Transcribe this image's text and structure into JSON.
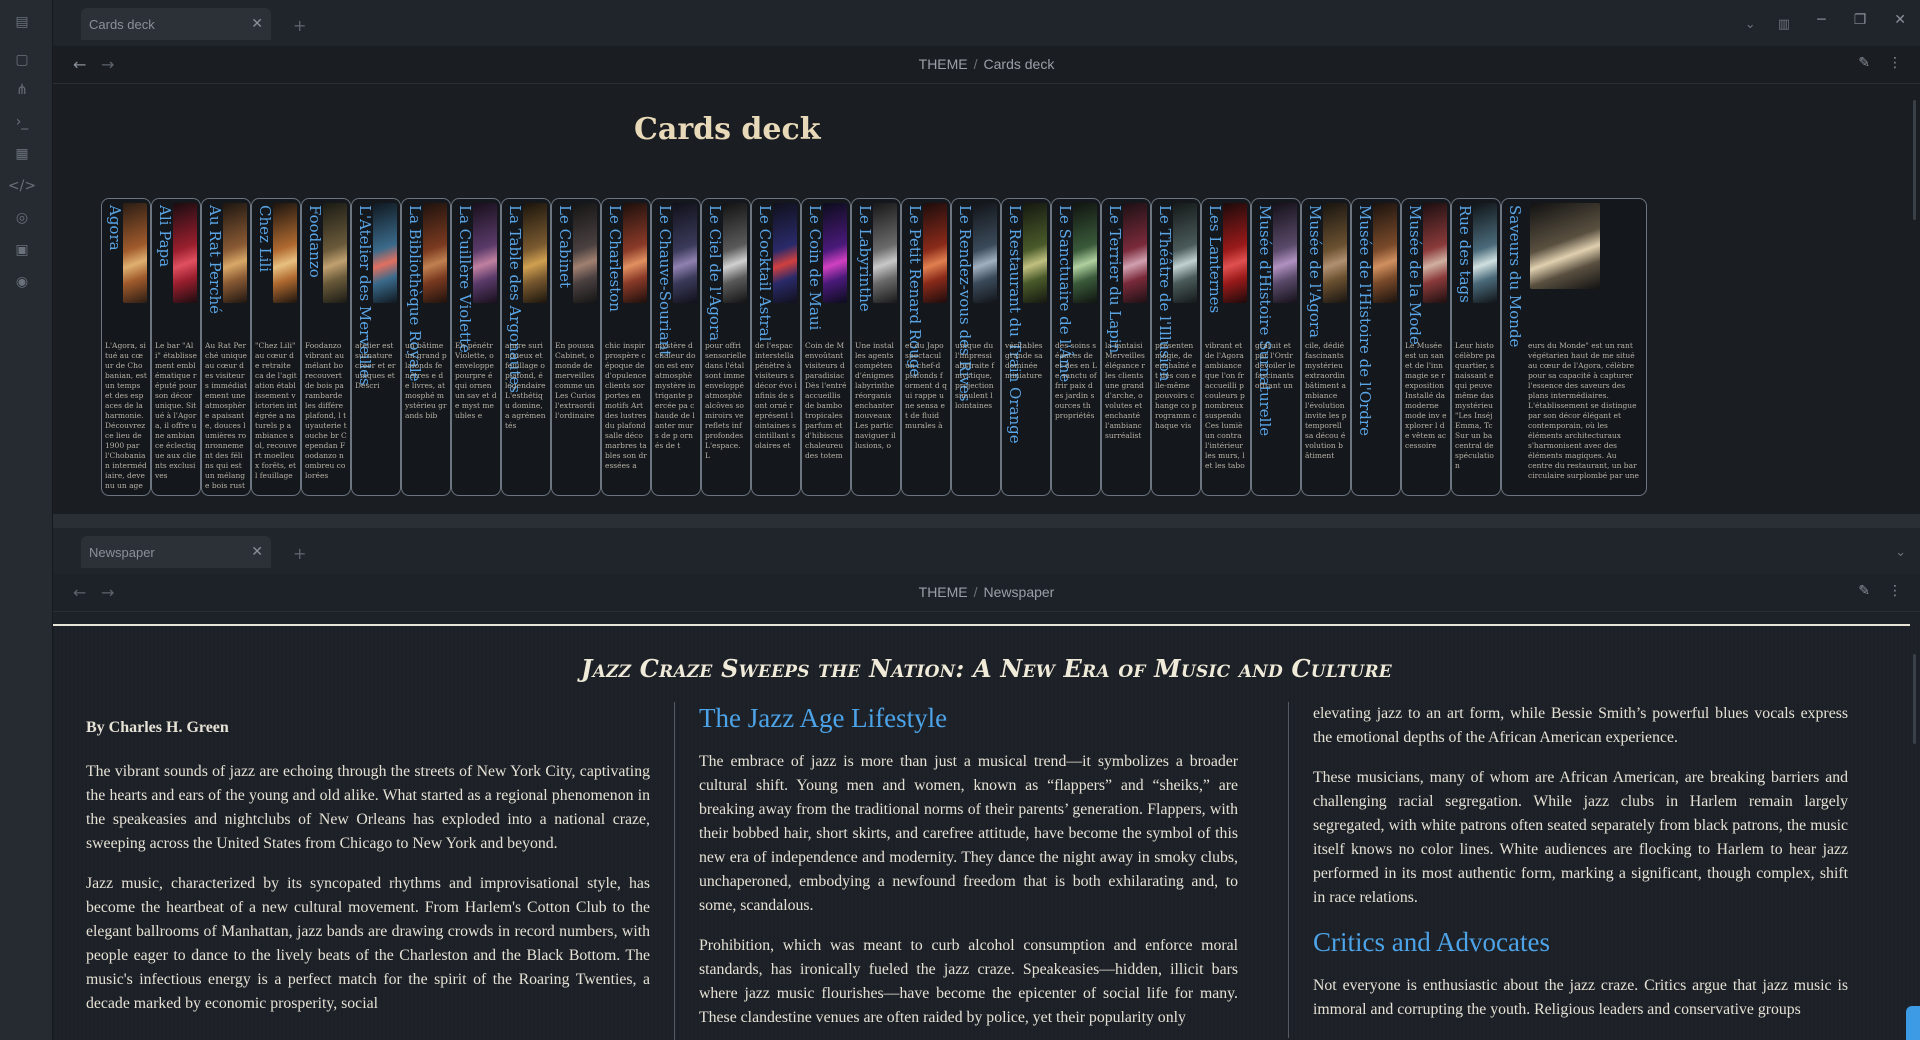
{
  "ribbon": {
    "icons": [
      "sidebar-toggle-icon",
      "file-icon",
      "graph-icon",
      "terminal-icon",
      "layout-icon",
      "code-icon",
      "location-icon",
      "calendar-icon",
      "help-icon"
    ]
  },
  "top_pane": {
    "tab_title": "Cards deck",
    "breadcrumb": {
      "root": "THEME",
      "sep": "/",
      "page": "Cards deck"
    },
    "title": "Cards deck",
    "cards": [
      {
        "title": "Agora",
        "text": "L'Agora, situé au cœur de Chobanian, est un temps et des espaces de la harmonie. Découvrez ce lieu de 1900 par l'Chobanian intermédiaire, devenu un agents de la rigidité cède la place à la possibilité. En travers"
      },
      {
        "title": "Ali Papa",
        "text": "Le bar \"Ali\" établissement emblématique réputé pour son décor unique. Situé à l'Agora, il offre une ambiance éclectique aux clients exclusives"
      },
      {
        "title": "Au Rat Perché",
        "text": "Au Rat Perché unique au cœur des visiteurs immédiatement une atmosphère apaisante, douces lumières ronronnement des félins qui est un mélange bois rustiques modernes ambiance accueillante"
      },
      {
        "title": "Chez Lili",
        "text": "\"Chez Lili\" au cœur de retraite ca de l'agitation établissement victorien intégrée a naturels p ambiance sol, recouvert moelleux forêts, et l feuillage"
      },
      {
        "title": "Foodanzo",
        "text": "Foodanzo vibrant au mélant bo recouvert de bois pa rambarde les différe plafond, l tuyauterie touche br Cependan Foodanzo nombreu colorées"
      },
      {
        "title": "L'Atelier des Merveilles",
        "text": "atelier est surnature créer et er uniques et Descri"
      },
      {
        "title": "La Bibliothèque Royale",
        "text": "un bâtime un grand plafonds fenêtres e de livres, atmosphé mystérieu grands bib"
      },
      {
        "title": "La Cuillère Violette",
        "text": "En pénétr Violette, o enveloppe pourpre é qui ornen un sav et de myst meubles e"
      },
      {
        "title": "La Table des Argonautes",
        "text": "anrre suri noueux et feuillage o plafond, é légendaire L'esthétiqu domine, a agrémentés"
      },
      {
        "title": "Le Cabinet",
        "text": "En poussa Cabinet, o monde de merveilles comme un Les Curios l'extraordi l'ordinaire"
      },
      {
        "title": "Le Charleston",
        "text": "chic inspir prospère c époque de d'opulence clients sor portes en motifs Art des lustres du plafond salle déco marbres tables son dressées a"
      },
      {
        "title": "Le Chauve-Souriant",
        "text": "mystère d chaleur do on est env atmosphè mystère intrigante percée pa chaude de lanter murs de p ornés de t"
      },
      {
        "title": "Le Ciel de l'Agora",
        "text": "pour offri sensorielle dans l'étal sont imme enveloppé atmosphè alcôves so miroirs ve reflets inf profondes L'espace. L"
      },
      {
        "title": "Le Cocktail Astral",
        "text": "de l'espac interstella pénètre à visiteurs s décor évo infinis de sont orné représent lointaines scintillant solaires et"
      },
      {
        "title": "Le Coin de Maui",
        "text": "Coin de M envoûtant visiteurs d paradisiac Dès l'entré accueillis de bambo tropicales parfum et d'hibiscus chaleureu des totem"
      },
      {
        "title": "Le Labyrinthe",
        "text": "Une instal les agents compéten d'énigmes labyrinthe réorganis enchanter nouveaux Les partic naviguer illusions, o"
      },
      {
        "title": "Le Petit Renard Rouge",
        "text": "et du Japo spectacul un chef-d plafonds forment d qui rappe une sensa et de fluid murales à"
      },
      {
        "title": "Le Rendez-vous des Rives",
        "text": "unique du l'impressi abstraite f mystique, projection simulent l lointaines"
      },
      {
        "title": "Le Restaurant du Train Orange",
        "text": "véritables grande sa dominée miniature"
      },
      {
        "title": "Le Sanctuaire de l'Âme",
        "text": "des soins séances de et des en Le sanctu offrir paix des jardin sources th propriétés"
      },
      {
        "title": "Le Terrier du Lapin",
        "text": "la fantaisi Merveilles élégance r les clients une grand d'arche, o volutes et enchanté l'ambianc surréalist"
      },
      {
        "title": "Le Théâtre de l'Illusion",
        "text": "présenten magie, de enchaîné et des con elle-même pouvoirs change co programm chaque vis"
      },
      {
        "title": "Les Lanternes",
        "text": "vibrant et de l'Agora ambiance que l'on fr accueilli p couleurs p nombreux suspendu Ces lumiè un contra l'intérieur les murs, l et les tabo"
      },
      {
        "title": "Musée d'Histoire Surnaturelle",
        "text": "gratuit et par l'Ordr dévoiler le fascinants offrant un"
      },
      {
        "title": "Musée de l'Agora",
        "text": "cile, dédié fascinants mystérieu extraordin bâtiment ambiance l'évolution invite les p temporell sa décou évolution bâtiment"
      },
      {
        "title": "Musée de l'Histoire de l'Ordre",
        "text": ""
      },
      {
        "title": "Musée de la Mode",
        "text": "Le Musée est un san et de l'inn magie se r exposition Installé da moderne mode inv explorer l de vêtem accessoire"
      },
      {
        "title": "Rue des tags",
        "text": "Leur histo célèbre pa quartier, s naissant e qui peuve même das mystérieu \"Les Inséj Emma, Tc Sur un ba central de spéculation"
      },
      {
        "title": "Saveurs du Monde",
        "text": "eurs du Monde\" est un rant végétarien haut de me situé au cœur de l'Agora, célèbre pour sa capacité à capturer l'essence des saveurs des plans intermédiaires. L'établissement se distingue par son décor élégant et contemporain, où les éléments architecturaux s'harmonisent avec des éléments magiques. Au centre du restaurant, un bar circulaire surplombé par une"
      }
    ]
  },
  "bottom_pane": {
    "tab_title": "Newspaper",
    "breadcrumb": {
      "root": "THEME",
      "sep": "/",
      "page": "Newspaper"
    },
    "headline": "Jazz Craze Sweeps the Nation: A New Era of Music and Culture",
    "byline": "By Charles H. Green",
    "col1": [
      "The vibrant sounds of jazz are echoing through the streets of New York City, captivating the hearts and ears of the young and old alike. What started as a regional phenomenon in the speakeasies and nightclubs of New Orleans has exploded into a national craze, sweeping across the United States from Chicago to New York and beyond.",
      "Jazz music, characterized by its syncopated rhythms and improvisational style, has become the heartbeat of a new cultural movement. From Harlem's Cotton Club to the elegant ballrooms of Manhattan, jazz bands are drawing crowds in record numbers, with people eager to dance to the lively beats of the Charleston and the Black Bottom. The music's infectious energy is a perfect match for the spirit of the Roaring Twenties, a decade marked by economic prosperity, social"
    ],
    "col2_heading": "The Jazz Age Lifestyle",
    "col2": [
      "The embrace of jazz is more than just a musical trend—it symbolizes a broader cultural shift. Young men and women, known as “flappers” and “sheiks,” are breaking away from the traditional norms of their parents’ generation. Flappers, with their bobbed hair, short skirts, and carefree attitude, have become the symbol of this new era of independence and modernity. They dance the night away in smoky clubs, unchaperoned, embodying a newfound freedom that is both exhilarating and, to some, scandalous.",
      "Prohibition, which was meant to curb alcohol consumption and enforce moral standards, has ironically fueled the jazz craze. Speakeasies—hidden, illicit bars where jazz music flourishes—have become the epicenter of social life for many. These clandestine venues are often raided by police, yet their popularity only"
    ],
    "col3": [
      "elevating jazz to an art form, while Bessie Smith’s powerful blues vocals express the emotional depths of the African American experience.",
      "These musicians, many of whom are African American, are breaking barriers and challenging racial segregation. While jazz clubs in Harlem remain largely segregated, with white patrons often seated separately from black patrons, the music itself knows no color lines. White audiences are flocking to Harlem to hear jazz performed in its most authentic form, marking a significant, though complex, shift in race relations."
    ],
    "col3_heading": "Critics and Advocates",
    "col3_after": "Not everyone is enthusiastic about the jazz craze. Critics argue that jazz music is immoral and corrupting the youth. Religious leaders and conservative groups"
  }
}
